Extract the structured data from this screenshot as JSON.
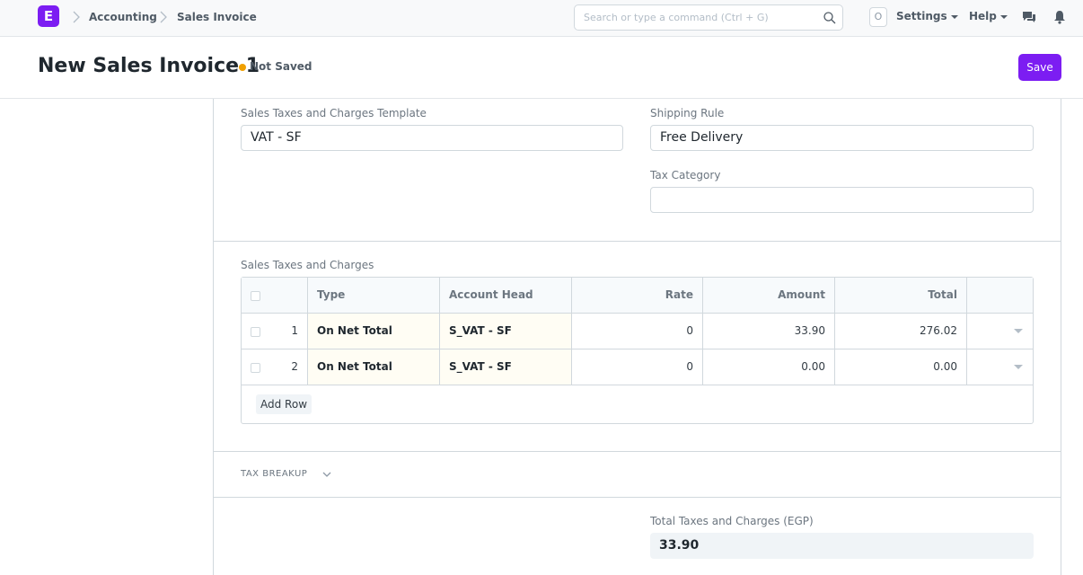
{
  "navbar": {
    "logo_letter": "E",
    "breadcrumbs": [
      "Accounting",
      "Sales Invoice"
    ],
    "search_placeholder": "Search or type a command (Ctrl + G)",
    "avatar_letter": "O",
    "settings_label": "Settings",
    "help_label": "Help"
  },
  "page": {
    "title": "New Sales Invoice 1",
    "status": "Not Saved",
    "save_label": "Save"
  },
  "taxes_section": {
    "template_label": "Sales Taxes and Charges Template",
    "template_value": "VAT - SF",
    "shipping_label": "Shipping Rule",
    "shipping_value": "Free Delivery",
    "tax_category_label": "Tax Category",
    "tax_category_value": ""
  },
  "charges_table": {
    "label": "Sales Taxes and Charges",
    "columns": [
      "Type",
      "Account Head",
      "Rate",
      "Amount",
      "Total"
    ],
    "rows": [
      {
        "idx": "1",
        "type": "On Net Total",
        "account": "S_VAT - SF",
        "rate": "0",
        "amount": "33.90",
        "total": "276.02"
      },
      {
        "idx": "2",
        "type": "On Net Total",
        "account": "S_VAT - SF",
        "rate": "0",
        "amount": "0.00",
        "total": "0.00"
      }
    ],
    "add_row_label": "Add Row"
  },
  "tax_breakup": {
    "label": "TAX BREAKUP"
  },
  "totals": {
    "label": "Total Taxes and Charges (EGP)",
    "value": "33.90"
  },
  "colors": {
    "brand": "#7c1df2",
    "status_dot": "#f0a000"
  }
}
